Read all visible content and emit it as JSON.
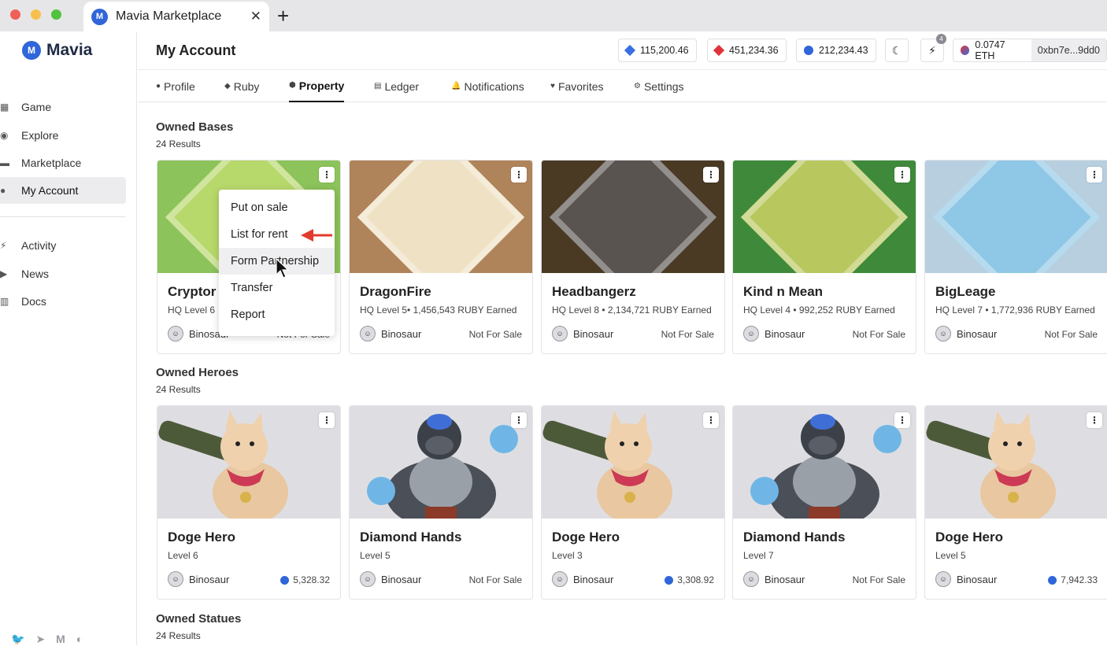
{
  "browser": {
    "tab_title": "Mavia Marketplace",
    "close_glyph": "✕",
    "new_tab_glyph": "+"
  },
  "brand": {
    "name": "Mavia",
    "mark": "M",
    "accent": "#2f66d9"
  },
  "sidebar": {
    "items": [
      {
        "label": "Game",
        "icon": "grid-icon"
      },
      {
        "label": "Explore",
        "icon": "compass-icon"
      },
      {
        "label": "Marketplace",
        "icon": "store-icon"
      },
      {
        "label": "My Account",
        "icon": "user-icon",
        "active": true
      }
    ],
    "secondary": [
      {
        "label": "Activity",
        "icon": "bolt-icon"
      },
      {
        "label": "News",
        "icon": "megaphone-icon"
      },
      {
        "label": "Docs",
        "icon": "book-icon"
      }
    ],
    "socials": [
      "twitter-icon",
      "telegram-icon",
      "medium-icon",
      "discord-icon"
    ]
  },
  "header": {
    "title": "My Account",
    "balances": [
      {
        "value": "115,200.46",
        "icon": "blue-gem-icon",
        "color": "#3a6fe0"
      },
      {
        "value": "451,234.36",
        "icon": "ruby-gem-icon",
        "color": "#e0323a"
      },
      {
        "value": "212,234.43",
        "icon": "mavia-coin-icon",
        "color": "#2f66d9"
      }
    ],
    "notification_count": "4",
    "eth_balance": "0.0747 ETH",
    "wallet_address": "0xbn7e...9dd0"
  },
  "tabs": [
    {
      "label": "Profile",
      "icon": "user-icon"
    },
    {
      "label": "Ruby",
      "icon": "gem-icon"
    },
    {
      "label": "Property",
      "icon": "cube-icon",
      "active": true
    },
    {
      "label": "Ledger",
      "icon": "ledger-icon"
    },
    {
      "label": "Notifications",
      "icon": "bell-icon"
    },
    {
      "label": "Favorites",
      "icon": "heart-icon"
    },
    {
      "label": "Settings",
      "icon": "gear-icon"
    }
  ],
  "sections": {
    "bases": {
      "title": "Owned Bases",
      "count": "24 Results"
    },
    "heroes": {
      "title": "Owned Heroes",
      "count": "24 Results"
    },
    "statues": {
      "title": "Owned Statues",
      "count": "24 Results"
    }
  },
  "bases": [
    {
      "name": "Cryptor",
      "meta": "HQ Level 6",
      "owner": "Binosaur",
      "status": "Not For Sale",
      "ground": "#8cc35a",
      "inner": "#b7d86a"
    },
    {
      "name": "DragonFire",
      "meta": "HQ Level 5• 1,456,543 RUBY Earned",
      "owner": "Binosaur",
      "status": "Not For Sale",
      "ground": "#b0845a",
      "inner": "#efe2c4"
    },
    {
      "name": "Headbangerz",
      "meta": "HQ Level 8 • 2,134,721 RUBY Earned",
      "owner": "Binosaur",
      "status": "Not For Sale",
      "ground": "#4a3a24",
      "inner": "#5a5450"
    },
    {
      "name": "Kind n Mean",
      "meta": "HQ Level 4 • 992,252 RUBY Earned",
      "owner": "Binosaur",
      "status": "Not For Sale",
      "ground": "#3f8a3a",
      "inner": "#b8c85e"
    },
    {
      "name": "BigLeage",
      "meta": "HQ Level 7 • 1,772,936 RUBY Earned",
      "owner": "Binosaur",
      "status": "Not For Sale",
      "ground": "#b8cfe0",
      "inner": "#8fc8e6"
    }
  ],
  "heroes": [
    {
      "name": "Doge Hero",
      "meta": "Level 6",
      "owner": "Binosaur",
      "status": "5,328.32",
      "price": true,
      "kind": "doge"
    },
    {
      "name": "Diamond Hands",
      "meta": "Level 5",
      "owner": "Binosaur",
      "status": "Not For Sale",
      "price": false,
      "kind": "gorilla"
    },
    {
      "name": "Doge Hero",
      "meta": "Level 3",
      "owner": "Binosaur",
      "status": "3,308.92",
      "price": true,
      "kind": "doge"
    },
    {
      "name": "Diamond Hands",
      "meta": "Level 7",
      "owner": "Binosaur",
      "status": "Not For Sale",
      "price": false,
      "kind": "gorilla"
    },
    {
      "name": "Doge Hero",
      "meta": "Level 5",
      "owner": "Binosaur",
      "status": "7,942.33",
      "price": true,
      "kind": "doge"
    }
  ],
  "context_menu": {
    "items": [
      "Put on sale",
      "List for rent",
      "Form Partnership",
      "Transfer",
      "Report"
    ],
    "hovered": "Form Partnership"
  }
}
